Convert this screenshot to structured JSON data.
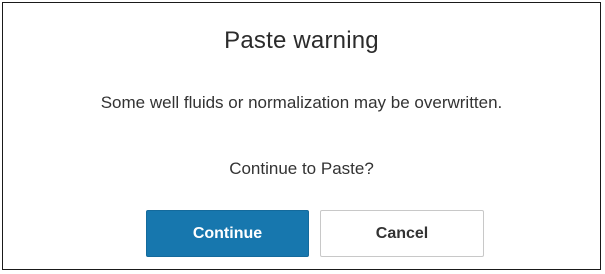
{
  "dialog": {
    "title": "Paste warning",
    "message": "Some well fluids or normalization may be overwritten.",
    "question": "Continue to Paste?",
    "continue_label": "Continue",
    "cancel_label": "Cancel"
  },
  "colors": {
    "primary_button": "#1777ae",
    "primary_button_text": "#ffffff",
    "secondary_button_border": "#c8c8c8",
    "dialog_border": "#1a1a1a"
  }
}
